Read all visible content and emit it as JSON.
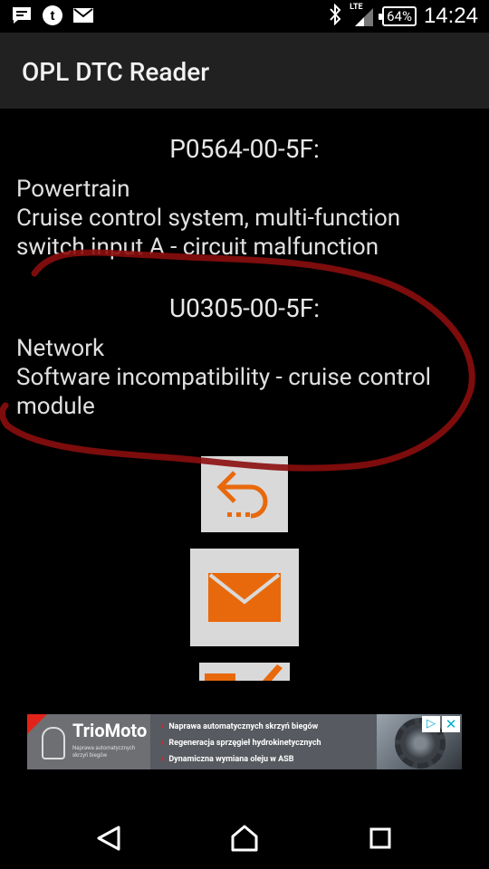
{
  "status_bar": {
    "notification_icons": [
      "message-icon",
      "tumblr-icon",
      "mail-icon"
    ],
    "network_label": "LTE",
    "battery": "64%",
    "time": "14:24"
  },
  "app_bar": {
    "title": "OPL DTC Reader"
  },
  "dtcs": [
    {
      "code": "P0564-00-5F:",
      "category": "Powertrain",
      "description": "Cruise control system, multi-function switch input A - circuit malfunction"
    },
    {
      "code": "U0305-00-5F:",
      "category": "Network",
      "description": "Software incompatibility - cruise control module"
    }
  ],
  "buttons": {
    "back_icon": "reply-icon",
    "mail_icon": "mail-icon",
    "accent_color": "#e8690c",
    "tile_color": "#d9d9d9"
  },
  "ad": {
    "brand": "TrioMoto",
    "brand_sub": "Naprawa automatycznych skrzyń biegów",
    "lines": [
      "Naprawa automatycznych skrzyń biegów",
      "Regeneracja sprzęgieł hydrokinetycznych",
      "Dynamiczna wymiana oleju w ASB"
    ],
    "adchoices_icon": "adchoices-icon",
    "close_icon": "close-icon"
  },
  "colors": {
    "annotation": "#8b0d0d",
    "app_bar_bg": "#212121",
    "background": "#000000"
  }
}
